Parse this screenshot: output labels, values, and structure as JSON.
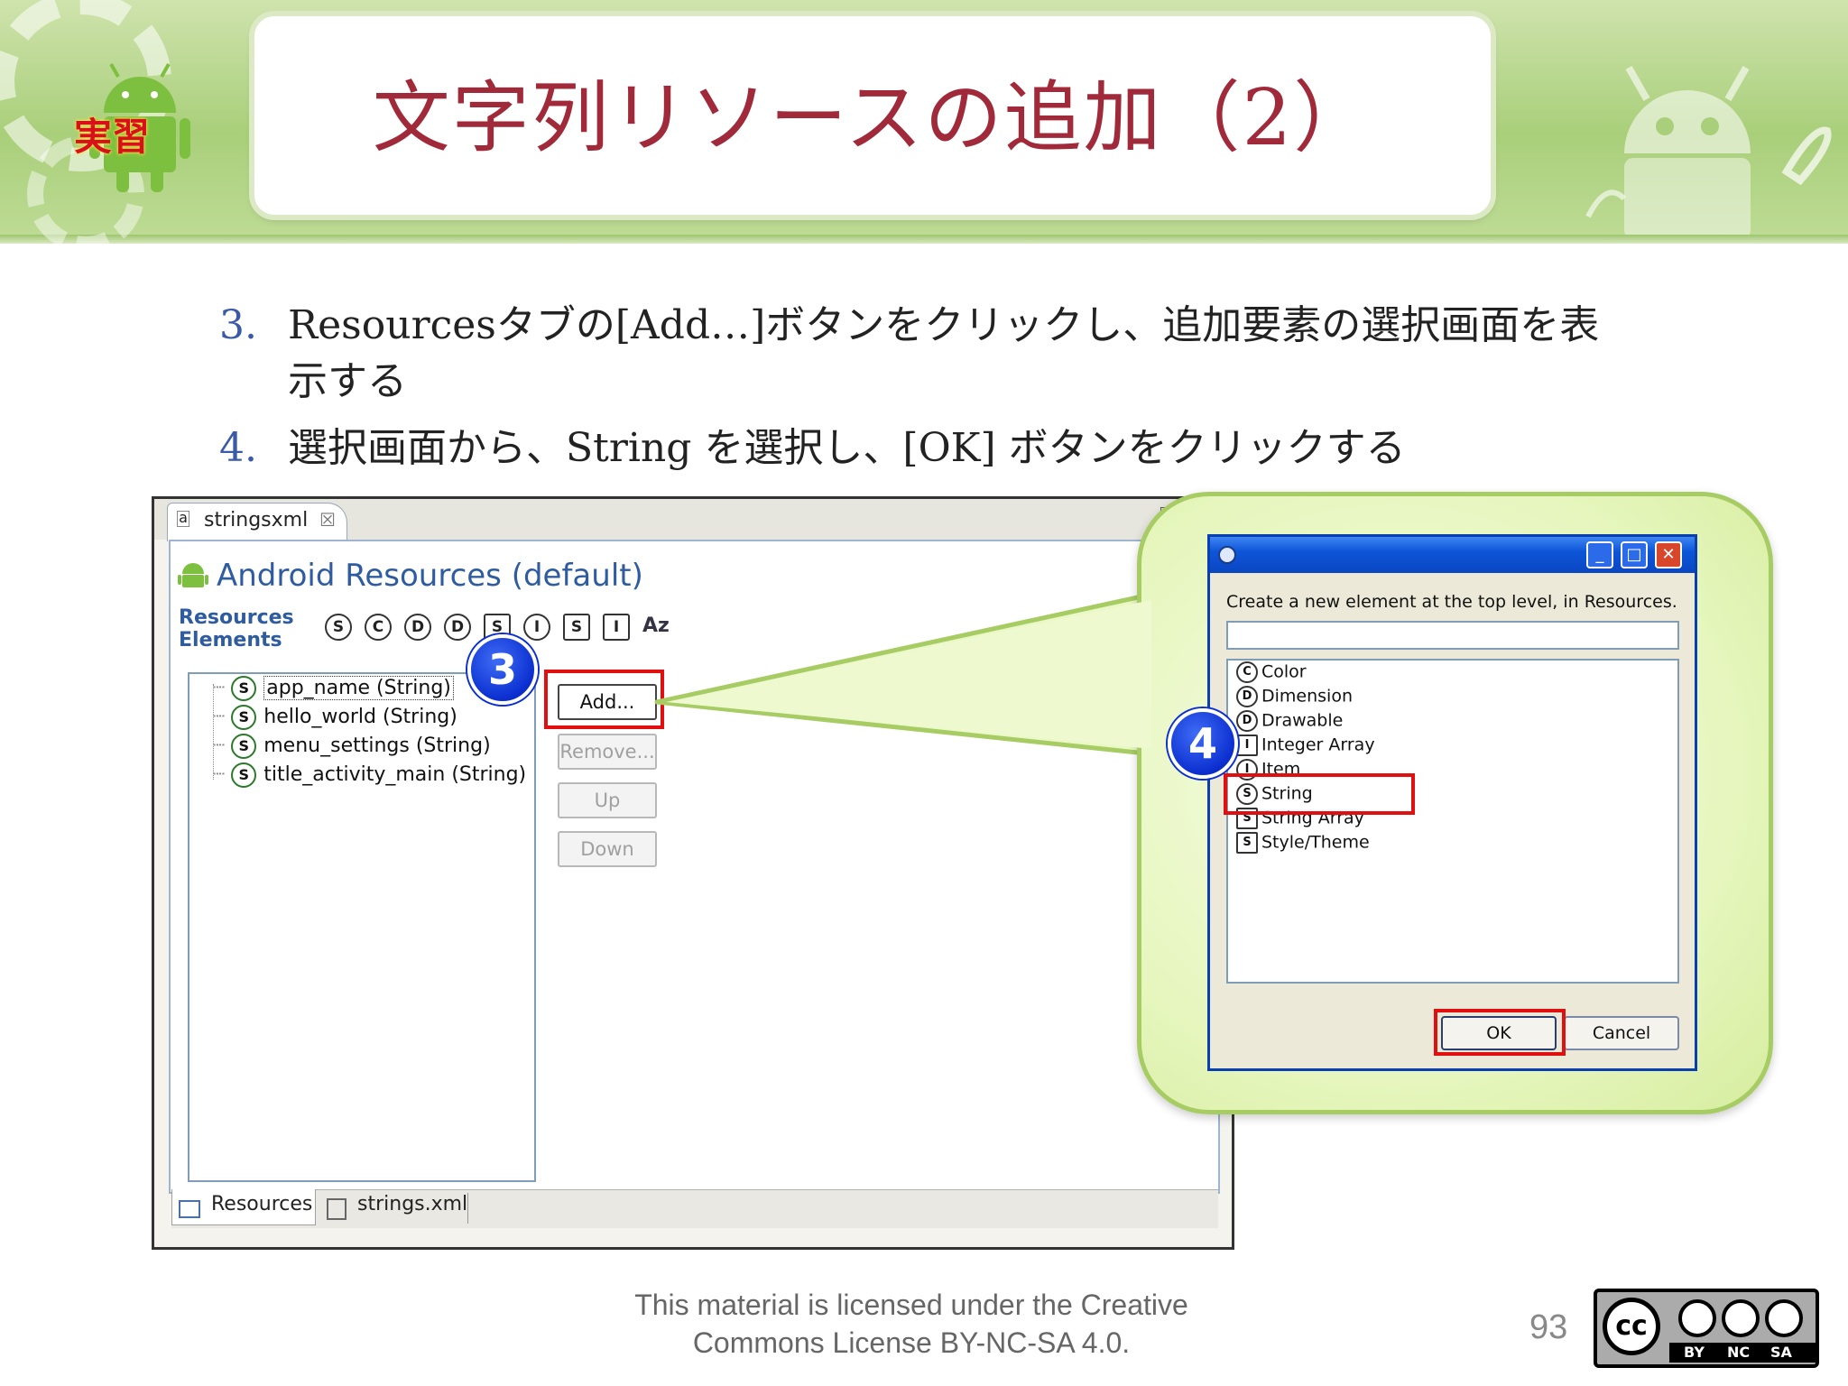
{
  "slide": {
    "title": "文字列リソースの追加（2）",
    "practice_badge": "実習",
    "bullets": [
      {
        "num": "3.",
        "text_line1": "Resourcesタブの[Add…]ボタンをクリックし、追加要素の選択画面を表",
        "text_line2": "示する"
      },
      {
        "num": "4.",
        "text_line1": "選択画面から、String を選択し、[OK] ボタンをクリックする"
      }
    ],
    "footer": {
      "line1": "This material is licensed under the Creative",
      "line2": "Commons License BY-NC-SA 4.0."
    },
    "page_number": "93",
    "cc_labels": {
      "cc": "cc",
      "by": "BY",
      "nc": "NC",
      "sa": "SA"
    }
  },
  "editor": {
    "tab_label": "stringsxml",
    "tab_close": "☒",
    "title": "Android Resources (default)",
    "label_line1": "Resources",
    "label_line2": "Elements",
    "type_icons": [
      "S",
      "C",
      "D",
      "D",
      "S",
      "I",
      "S",
      "I",
      "Az"
    ],
    "tree_items": [
      "app_name (String)",
      "hello_world (String)",
      "menu_settings (String)",
      "title_activity_main (String)"
    ],
    "buttons": {
      "add": "Add...",
      "remove": "Remove...",
      "up": "Up",
      "down": "Down"
    },
    "bottom_tabs": [
      "Resources",
      "strings.xml"
    ]
  },
  "dialog": {
    "prompt": "Create a new element at the top level, in Resources.",
    "input_value": "",
    "list": [
      {
        "icon": "C",
        "label": "Color"
      },
      {
        "icon": "D",
        "label": "Dimension"
      },
      {
        "icon": "D",
        "label": "Drawable"
      },
      {
        "icon": "I",
        "label": "Integer Array"
      },
      {
        "icon": "I",
        "label": "Item"
      },
      {
        "icon": "S",
        "label": "String"
      },
      {
        "icon": "S",
        "label": "String Array"
      },
      {
        "icon": "S",
        "label": "Style/Theme"
      }
    ],
    "ok": "OK",
    "cancel": "Cancel"
  },
  "steps": {
    "step3": "3",
    "step4": "4"
  },
  "colors": {
    "title": "#a12a3a",
    "accent_blue": "#2f5ca0",
    "highlight_red": "#e01010",
    "header_green": "#a9cf7a"
  }
}
